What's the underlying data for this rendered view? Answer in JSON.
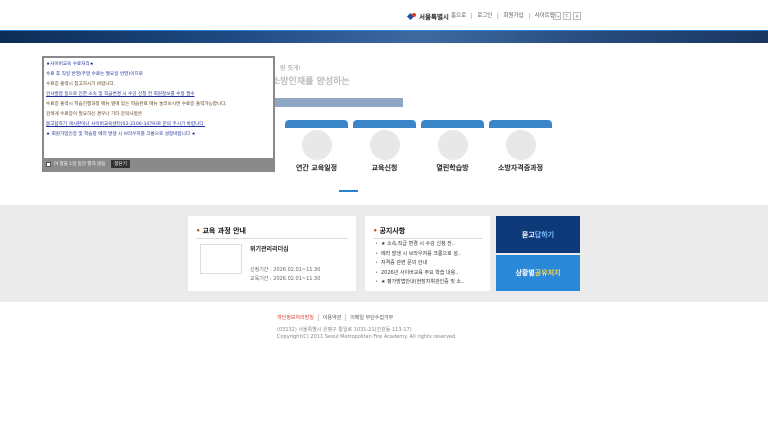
{
  "header": {
    "logo_text": "서울특별시",
    "links": [
      "홈으로",
      "로그인",
      "회원가입",
      "사이트맵"
    ],
    "font_controls": [
      "T+",
      "T-",
      "A"
    ]
  },
  "hero": {
    "line1": "람 짓게!",
    "line2": "소방인재를 양성하는"
  },
  "quick_menu": [
    {
      "label": "연간 교육일정"
    },
    {
      "label": "교육신청"
    },
    {
      "label": "열린학습방"
    },
    {
      "label": "소방자격증과정"
    }
  ],
  "course_card": {
    "title": "교육 과정 안내",
    "course_name": "위기관리리더십",
    "apply_period": "신청기간 : 2026.02.01~11.30",
    "edu_period": "교육기간 : 2026.02.01~11.30"
  },
  "notice_card": {
    "title": "공지사항",
    "items": [
      "★ 소속,직급 변경 시 수강 신청 전..",
      "에러 발생 시 브라우저를 크롬으로 설..",
      "자격증 관련 문의 안내",
      "2026년 사이버교육 주요 학습 내용..",
      "★ 평가방법안내(현장지휘관인증 및 소.."
    ]
  },
  "buttons": {
    "qa_prefix": "묻고 ",
    "qa_highlight": "답하기",
    "counsel_prefix": "상황별 ",
    "counsel_highlight": "공유처지"
  },
  "footer": {
    "links": [
      "개인정보처리방침",
      "이용약관",
      "이메일 무단수집거부"
    ],
    "address": "(03132) 서울특별시 은평구 통일로 1031-21(진관동 113-17)",
    "copyright": "Copyright(C) 2011 Seoul Metropolitan Fire Academy. All rights reserved."
  },
  "popup": {
    "lines": [
      {
        "text": "★사이버교육 수료처리★",
        "style": "blue"
      },
      {
        "text": "수료 후 직일 반영(주말 수료는 월요일 반영)이므로",
        "style": "blue"
      },
      {
        "text": "수료증 출력시 참고하시기 바랍니다.",
        "style": "brown"
      },
      {
        "text": "인사발령 등으로 인한 소속 및 직급변경 시 수강 신청 전 회원정보를 수정 필수",
        "style": "blue"
      },
      {
        "text": "수료증 출력시 학습진행과정 메뉴 옆에 있는 학습완료 메뉴 눌러보시면 수료증 출력가능합니다.",
        "style": "brown"
      },
      {
        "text": "검색게 수료증이 필요하신 경우나 기타 문의사항은",
        "style": "brown"
      },
      {
        "text": "묻고답하기 게시판이나 사이버교육센터(02-2106-3479)로 문의 주시기 바랍니다.",
        "style": "blue"
      },
      {
        "text": "★ 회원가입인증 및 학습창 에러 발생 시 브라우저를 크롬으로 설정바랍니다 ★",
        "style": "blue"
      }
    ],
    "checkbox_label": "이 창을 1일 동안 열지 않음",
    "close_label": "창닫기"
  }
}
